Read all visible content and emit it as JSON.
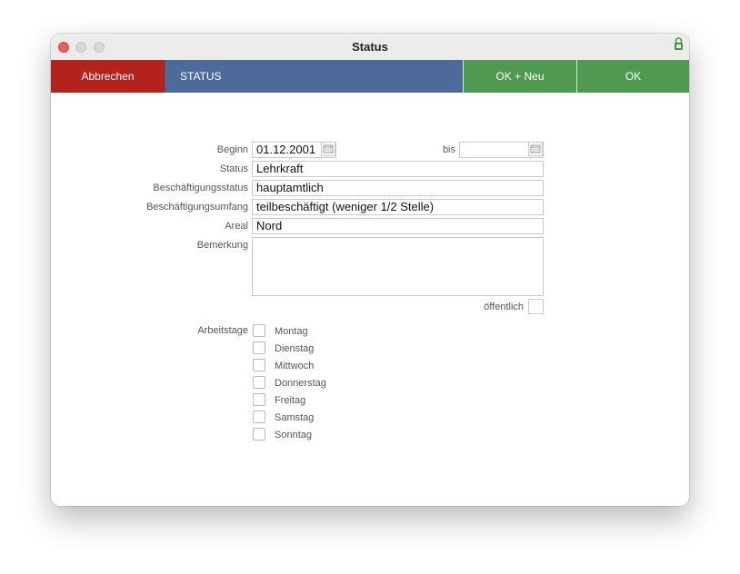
{
  "window": {
    "title": "Status"
  },
  "toolbar": {
    "cancel_label": "Abbrechen",
    "section_label": "STATUS",
    "ok_new_label": "OK + Neu",
    "ok_label": "OK"
  },
  "colors": {
    "cancel": "#b4221c",
    "section": "#4c6b9a",
    "ok": "#4f9a50",
    "lock": "#3c9a3c"
  },
  "form": {
    "beginn_label": "Beginn",
    "beginn_value": "01.12.2001",
    "bis_label": "bis",
    "bis_value": "",
    "status_label": "Status",
    "status_value": "Lehrkraft",
    "beschaeftigungsstatus_label": "Beschäftigungsstatus",
    "beschaeftigungsstatus_value": "hauptamtlich",
    "beschaeftigungsumfang_label": "Beschäftigungsumfang",
    "beschaeftigungsumfang_value": "teilbeschäftigt (weniger 1/2 Stelle)",
    "areal_label": "Areal",
    "areal_value": "Nord",
    "bemerkung_label": "Bemerkung",
    "bemerkung_value": "",
    "oeffentlich_label": "öffentlich",
    "oeffentlich_checked": false
  },
  "arbeitstage": {
    "label": "Arbeitstage",
    "days": [
      {
        "label": "Montag",
        "checked": false
      },
      {
        "label": "Dienstag",
        "checked": false
      },
      {
        "label": "Mittwoch",
        "checked": false
      },
      {
        "label": "Donnerstag",
        "checked": false
      },
      {
        "label": "Freitag",
        "checked": false
      },
      {
        "label": "Samstag",
        "checked": false
      },
      {
        "label": "Sonntag",
        "checked": false
      }
    ]
  },
  "icons": {
    "lock": "lock-icon",
    "calendar": "calendar-icon"
  }
}
